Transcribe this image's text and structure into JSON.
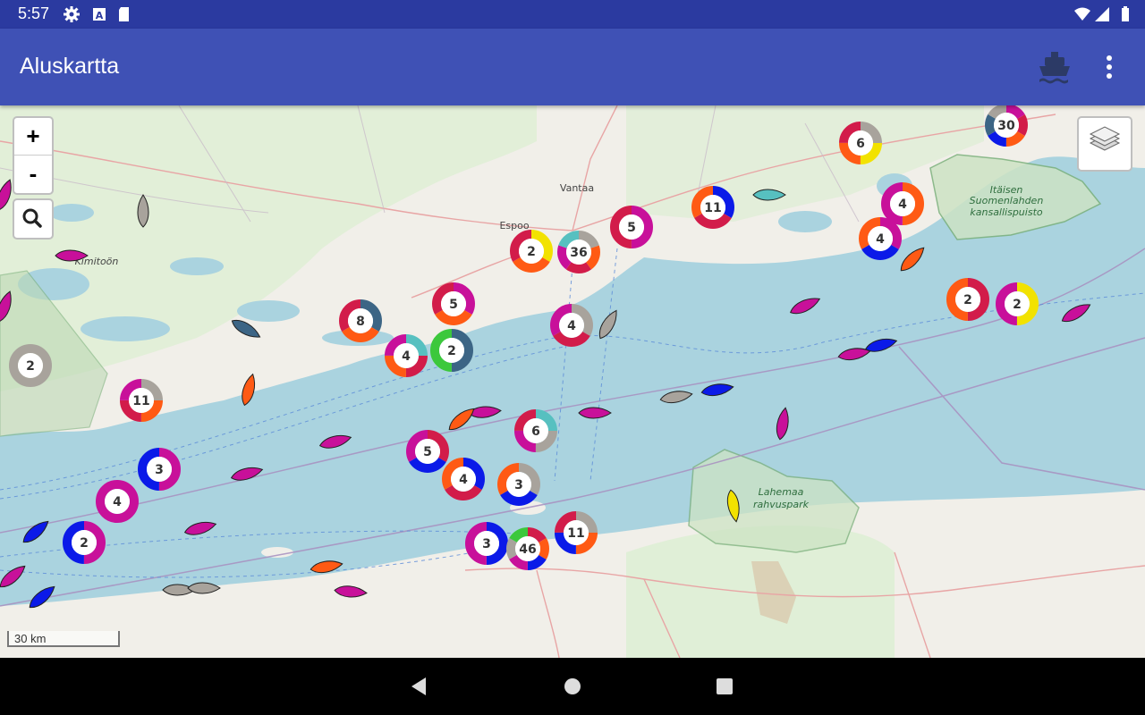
{
  "status_bar": {
    "time": "5:57",
    "left_icons": [
      "gear-icon",
      "a-letter-icon",
      "sd-card-icon"
    ],
    "right_icons": [
      "wifi-icon",
      "signal-icon",
      "battery-icon"
    ]
  },
  "app_bar": {
    "title": "Aluskartta",
    "actions": [
      "ship-icon",
      "more-vert-icon"
    ]
  },
  "map": {
    "zoom_in_label": "+",
    "zoom_out_label": "-",
    "search_icon": "search-icon",
    "layers_icon": "layers-icon",
    "scale_label": "30 km",
    "place_labels": [
      "Vantaa",
      "Espoo",
      "Kimitoön"
    ],
    "park_labels": [
      [
        "Itäisen",
        "Suomenlahden",
        "kansallispuisto"
      ],
      [
        "Lahemaa",
        "rahvuspark"
      ]
    ],
    "clusters": [
      {
        "count": "30"
      },
      {
        "count": "6"
      },
      {
        "count": "11"
      },
      {
        "count": "4"
      },
      {
        "count": "4"
      },
      {
        "count": "5"
      },
      {
        "count": "2"
      },
      {
        "count": "36"
      },
      {
        "count": "2"
      },
      {
        "count": "2"
      },
      {
        "count": "5"
      },
      {
        "count": "8"
      },
      {
        "count": "4"
      },
      {
        "count": "2"
      },
      {
        "count": "4"
      },
      {
        "count": "2"
      },
      {
        "count": "11"
      },
      {
        "count": "6"
      },
      {
        "count": "5"
      },
      {
        "count": "3"
      },
      {
        "count": "4"
      },
      {
        "count": "3"
      },
      {
        "count": "4"
      },
      {
        "count": "2"
      },
      {
        "count": "3"
      },
      {
        "count": "46"
      },
      {
        "count": "11"
      }
    ],
    "colors": {
      "magenta": "#c8109a",
      "orange": "#ff5a14",
      "blue": "#0b1ae8",
      "gray": "#a8a39c",
      "crimson": "#d21c4a",
      "yellow": "#f2e200",
      "teal": "#57c0c0",
      "slate": "#3c6585",
      "green": "#3cc83c"
    }
  },
  "nav_bar": {
    "buttons": [
      "back-icon",
      "home-icon",
      "recents-icon"
    ]
  }
}
